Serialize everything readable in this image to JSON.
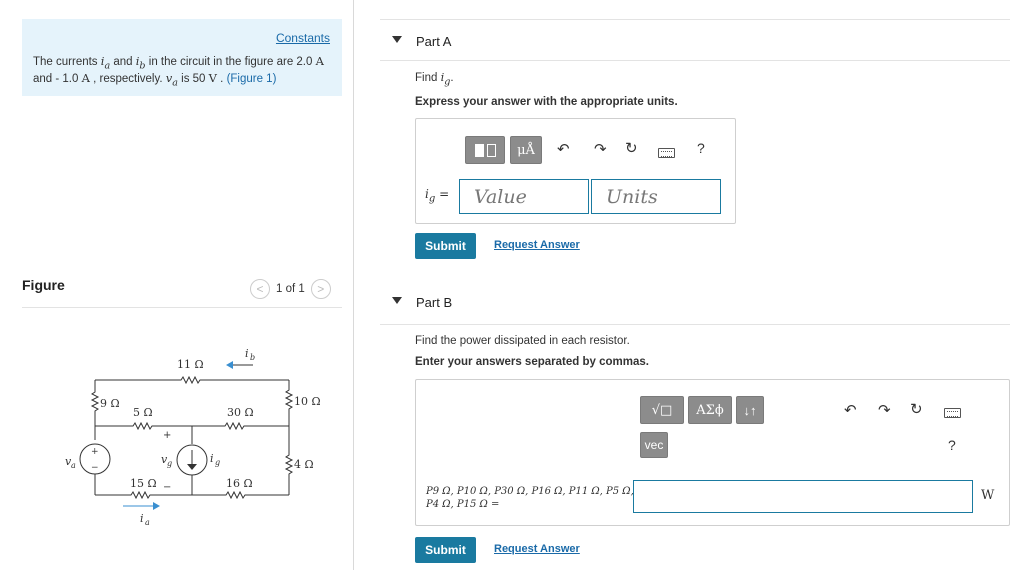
{
  "left": {
    "constants_link": "Constants",
    "intro": {
      "t1": "The currents ",
      "ia": "i",
      "ia_sub": "a",
      "t2": " and ",
      "ib": "i",
      "ib_sub": "b",
      "t3": " in the circuit in the figure are 2.0 ",
      "unit1": "A",
      "t4": " and - 1.0 ",
      "unit2": "A",
      "t5": " , respectively. ",
      "va": "v",
      "va_sub": "a",
      "t6": " is 50 ",
      "unit3": "V",
      "t7": " . ",
      "figure_link": "(Figure 1)"
    },
    "figure_heading": "Figure",
    "pager": {
      "prev": "<",
      "text": "1 of 1",
      "next": ">"
    },
    "circuit": {
      "r11": "11 Ω",
      "r9": "9 Ω",
      "r5": "5 Ω",
      "r30": "30 Ω",
      "r10": "10 Ω",
      "r4": "4 Ω",
      "r15": "15 Ω",
      "r16": "16 Ω",
      "ib": "i",
      "ib_sub": "b",
      "ia": "i",
      "ia_sub": "a",
      "va": "v",
      "va_sub": "a",
      "vg": "v",
      "vg_sub": "g",
      "ig": "i",
      "ig_sub": "g",
      "plus": "+",
      "minus": "−"
    }
  },
  "part_a": {
    "title": "Part A",
    "find_prefix": "Find ",
    "find_var": "i",
    "find_sub": "g",
    "find_suffix": ".",
    "instruction": "Express your answer with the appropriate units.",
    "toolbar": {
      "units_btn": "μÅ",
      "help": "?"
    },
    "input_label": "i",
    "input_label_sub": "g",
    "input_eq": " =",
    "value_placeholder": "Value",
    "units_placeholder": "Units",
    "submit": "Submit",
    "request": "Request Answer"
  },
  "part_b": {
    "title": "Part B",
    "question": "Find the power dissipated in each resistor.",
    "instruction": "Enter your answers separated by commas.",
    "toolbar": {
      "sqrt_btn": "√□",
      "greek_btn": "ΑΣϕ",
      "sort_btn": "↓↑",
      "vec_btn": "vec",
      "help": "?"
    },
    "input_label_line1": "P9 Ω, P10 Ω, P30 Ω, P16 Ω, P11 Ω, P5 Ω,",
    "input_label_line2": "P4 Ω, P15 Ω =",
    "unit": "W",
    "submit": "Submit",
    "request": "Request Answer"
  },
  "colors": {
    "accent": "#1a7aa0",
    "link": "#1a6aa8",
    "intro_bg": "#e5f3fb",
    "toolbar_btn": "#8c8c8c"
  }
}
